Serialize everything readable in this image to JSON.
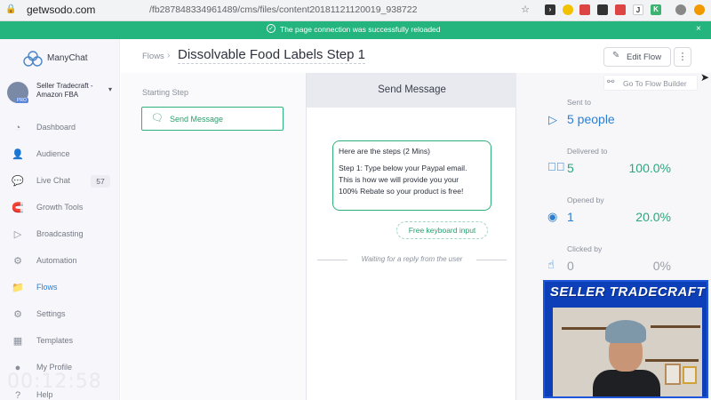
{
  "browser": {
    "url_host": "getwsodo.com",
    "url_path": "/fb287848334961489/cms/files/content20181121120019_938722"
  },
  "notification": {
    "message": "The page connection was successfully reloaded",
    "close": "×"
  },
  "sidebar": {
    "brand": "ManyChat",
    "account_name": "Seller Tradecraft - Amazon FBA",
    "pro_badge": "PRO",
    "items": [
      {
        "label": "Dashboard",
        "icon": "dashboard-icon",
        "glyph": "◔"
      },
      {
        "label": "Audience",
        "icon": "audience-icon",
        "glyph": "👤"
      },
      {
        "label": "Live Chat",
        "icon": "live-chat-icon",
        "glyph": "💬",
        "badge": "57"
      },
      {
        "label": "Growth Tools",
        "icon": "growth-tools-icon",
        "glyph": "🧲"
      },
      {
        "label": "Broadcasting",
        "icon": "broadcasting-icon",
        "glyph": "▷"
      },
      {
        "label": "Automation",
        "icon": "automation-icon",
        "glyph": "⚙"
      },
      {
        "label": "Flows",
        "icon": "flows-icon",
        "glyph": "📁",
        "active": true
      },
      {
        "label": "Settings",
        "icon": "settings-icon",
        "glyph": "⚙"
      },
      {
        "label": "Templates",
        "icon": "templates-icon",
        "glyph": "▦"
      },
      {
        "label": "My Profile",
        "icon": "my-profile-icon",
        "glyph": "●"
      },
      {
        "label": "Help",
        "icon": "help-icon",
        "glyph": "?"
      }
    ],
    "timer": "00:12:58"
  },
  "header": {
    "breadcrumb": "Flows",
    "title": "Dissolvable Food Labels Step 1",
    "edit_flow": "Edit Flow",
    "more": "⋮"
  },
  "starting": {
    "label": "Starting Step",
    "step": "Send Message"
  },
  "message": {
    "header": "Send Message",
    "lines": [
      "Here are the steps (2 Mins)",
      "Step 1: Type below your Paypal email.",
      "This is how we will provide you your",
      "100% Rebate so your product is free!"
    ],
    "keyboard_input": "Free keyboard input",
    "waiting": "Waiting for a reply from the user"
  },
  "stats": {
    "goto_builder": "Go To Flow Builder",
    "sent_label": "Sent to",
    "sent_value": "5 people",
    "delivered_label": "Delivered to",
    "delivered_value": "5",
    "delivered_pct": "100.0%",
    "opened_label": "Opened by",
    "opened_value": "1",
    "opened_pct": "20.0%",
    "clicked_label": "Clicked by",
    "clicked_value": "0",
    "clicked_pct": "0%"
  },
  "webcam": {
    "title": "SELLER TRADECRAFT"
  }
}
